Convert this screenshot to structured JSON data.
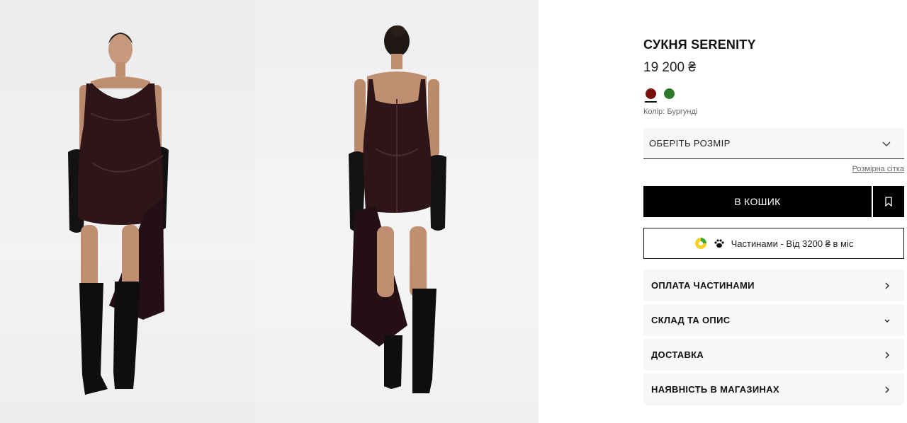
{
  "product": {
    "title": "СУКНЯ SERENITY",
    "price": "19 200 ₴"
  },
  "colors": {
    "swatches": [
      {
        "name": "burgundy",
        "hex": "#7a0f0f",
        "active": true
      },
      {
        "name": "green",
        "hex": "#2f7a2a",
        "active": false
      }
    ],
    "label_prefix": "Колір:",
    "selected": "Бургунді"
  },
  "size": {
    "placeholder": "ОБЕРІТЬ РОЗМІР",
    "icon": "chevron-down-icon",
    "chart_link": "Розмірна сітка"
  },
  "actions": {
    "add_to_cart": "В КОШИК",
    "wishlist_icon": "bookmark-icon"
  },
  "installments": {
    "text": "Частинами - Від 3200 ₴ в міс",
    "icons": [
      "bank-logo-icon",
      "paw-icon"
    ]
  },
  "accordion": [
    {
      "label": "ОПЛАТА ЧАСТИНАМИ",
      "icon": "chevron-right-icon"
    },
    {
      "label": "СКЛАД ТА ОПИС",
      "icon": "chevron-down-icon"
    },
    {
      "label": "ДОСТАВКА",
      "icon": "chevron-right-icon"
    },
    {
      "label": "НАЯВНІСТЬ В МАГАЗИНАХ",
      "icon": "chevron-right-icon"
    }
  ]
}
